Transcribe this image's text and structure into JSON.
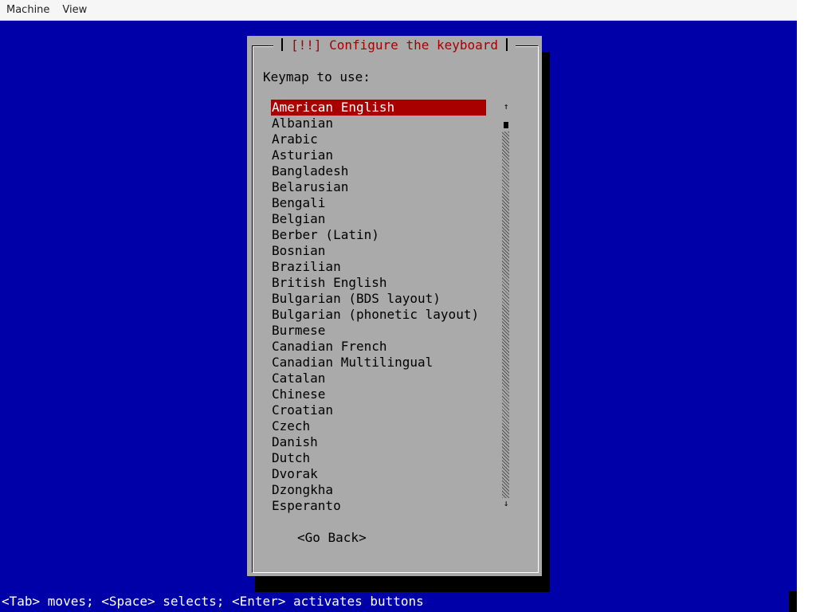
{
  "menubar": {
    "items": [
      "Machine",
      "View"
    ]
  },
  "dialog": {
    "title": "[!!] Configure the keyboard",
    "prompt": "Keymap to use:",
    "selected_value": "American English",
    "options": [
      "American English",
      "Albanian",
      "Arabic",
      "Asturian",
      "Bangladesh",
      "Belarusian",
      "Bengali",
      "Belgian",
      "Berber (Latin)",
      "Bosnian",
      "Brazilian",
      "British English",
      "Bulgarian (BDS layout)",
      "Bulgarian (phonetic layout)",
      "Burmese",
      "Canadian French",
      "Canadian Multilingual",
      "Catalan",
      "Chinese",
      "Croatian",
      "Czech",
      "Danish",
      "Dutch",
      "Dvorak",
      "Dzongkha",
      "Esperanto"
    ],
    "scroll_up_glyph": "↑",
    "scroll_down_glyph": "↓",
    "back_button": "<Go Back>"
  },
  "help_line": "<Tab> moves; <Space> selects; <Enter> activates buttons",
  "colors": {
    "console_bg": "#0000a8",
    "dialog_bg": "#aaaaaa",
    "title_fg": "#a80000",
    "selection_bg": "#a80000",
    "selection_fg": "#ffffff"
  }
}
